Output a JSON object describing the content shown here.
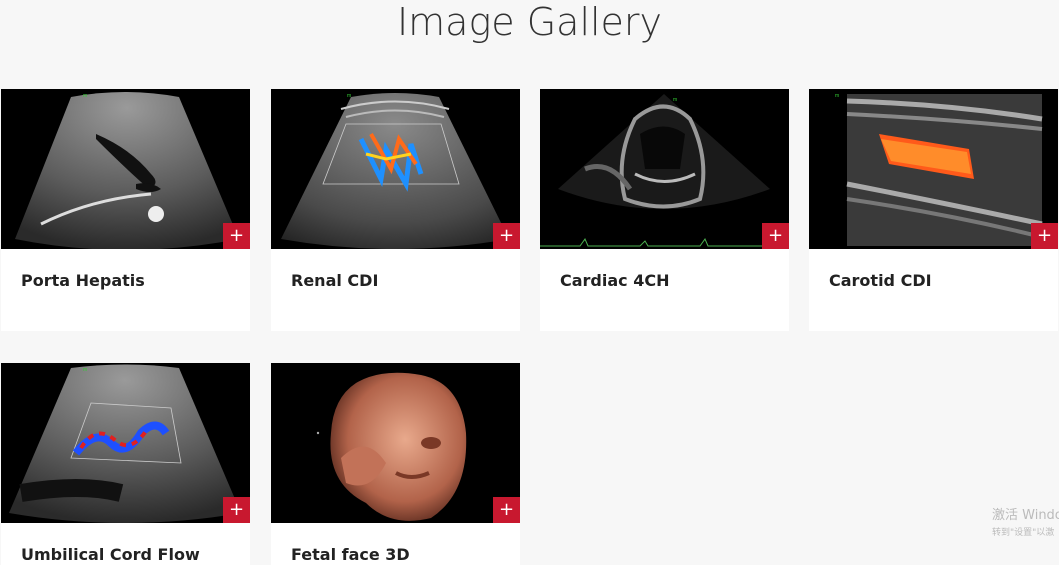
{
  "title": "Image Gallery",
  "cards": [
    {
      "label": "Porta Hepatis",
      "action": "+"
    },
    {
      "label": "Renal CDI",
      "action": "+"
    },
    {
      "label": "Cardiac 4CH",
      "action": "+"
    },
    {
      "label": "Carotid CDI",
      "action": "+"
    },
    {
      "label": "Umbilical Cord Flow",
      "action": "+"
    },
    {
      "label": "Fetal face 3D",
      "action": "+"
    }
  ],
  "watermark": {
    "line1": "激活 Windo",
    "line2": "转到\"设置\"以激"
  },
  "colors": {
    "accent": "#c8182f",
    "background": "#f7f7f7"
  }
}
